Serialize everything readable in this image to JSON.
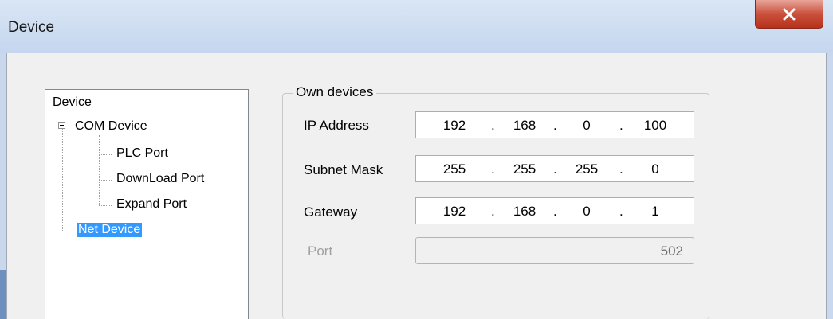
{
  "window": {
    "title": "Device"
  },
  "tree": {
    "root": "Device",
    "com_device": "COM Device",
    "children": [
      "PLC Port",
      "DownLoad Port",
      "Expand Port"
    ],
    "net_device": "Net Device"
  },
  "group": {
    "legend": "Own devices",
    "ip_label": "IP Address",
    "ip": [
      "192",
      "168",
      "0",
      "100"
    ],
    "mask_label": "Subnet Mask",
    "mask": [
      "255",
      "255",
      "255",
      "0"
    ],
    "gateway_label": "Gateway",
    "gateway": [
      "192",
      "168",
      "0",
      "1"
    ],
    "port_label": "Port",
    "port_value": "502"
  }
}
